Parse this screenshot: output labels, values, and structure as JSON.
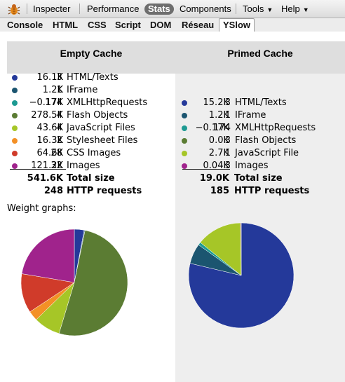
{
  "toolbar": {
    "inspecter": "Inspecter",
    "performance": "Performance",
    "stats": "Stats",
    "components": "Components",
    "tools": "Tools",
    "help": "Help"
  },
  "tabs": [
    "Console",
    "HTML",
    "CSS",
    "Script",
    "DOM",
    "Réseau",
    "YSlow"
  ],
  "active_tab": "YSlow",
  "empty_cache": {
    "title": "Empty Cache",
    "rows": [
      {
        "size": "16.1K",
        "count": "3",
        "label": "HTML/Texts",
        "color": "#24399a"
      },
      {
        "size": "1.2K",
        "count": "1",
        "label": "IFrame",
        "color": "#1b5570"
      },
      {
        "size": "−0.17K",
        "count": "174",
        "label": "XMLHttpRequests",
        "color": "#1d9a92"
      },
      {
        "size": "278.5K",
        "count": "4",
        "label": "Flash Objects",
        "color": "#5b7c33"
      },
      {
        "size": "43.6K",
        "count": "4",
        "label": "JavaScript Files",
        "color": "#a6c627"
      },
      {
        "size": "16.3K",
        "count": "2",
        "label": "Stylesheet Files",
        "color": "#f39026"
      },
      {
        "size": "64.6K",
        "count": "28",
        "label": "CSS Images",
        "color": "#d03b2a"
      },
      {
        "size": "121.2K",
        "count": "32",
        "label": "Images",
        "color": "#a0238c"
      }
    ],
    "total_size": "541.6K",
    "total_size_label": "Total size",
    "http_requests": "248",
    "http_requests_label": "HTTP requests"
  },
  "primed_cache": {
    "title": "Primed Cache",
    "rows": [
      {
        "size": "15.2K",
        "count": "3",
        "label": "HTML/Texts",
        "color": "#24399a"
      },
      {
        "size": "1.2K",
        "count": "1",
        "label": "IFrame",
        "color": "#1b5570"
      },
      {
        "size": "−0.17K",
        "count": "174",
        "label": "XMLHttpRequests",
        "color": "#1d9a92"
      },
      {
        "size": "0.0K",
        "count": "3",
        "label": "Flash Objects",
        "color": "#5b7c33"
      },
      {
        "size": "2.7K",
        "count": "1",
        "label": "JavaScript File",
        "color": "#a6c627"
      },
      {
        "size": "0.04K",
        "count": "3",
        "label": "Images",
        "color": "#a0238c"
      }
    ],
    "total_size": "19.0K",
    "total_size_label": "Total size",
    "http_requests": "185",
    "http_requests_label": "HTTP requests"
  },
  "weight_graphs_label": "Weight graphs:",
  "chart_data": [
    {
      "type": "pie",
      "categories": [
        "HTML/Texts",
        "IFrame",
        "XMLHttpRequests",
        "Flash Objects",
        "JavaScript Files",
        "Stylesheet Files",
        "CSS Images",
        "Images"
      ],
      "values": [
        16.1,
        1.2,
        0.17,
        278.5,
        43.6,
        16.3,
        64.6,
        121.2
      ],
      "colors": [
        "#24399a",
        "#1b5570",
        "#1d9a92",
        "#5b7c33",
        "#a6c627",
        "#f39026",
        "#d03b2a",
        "#a0238c"
      ]
    },
    {
      "type": "pie",
      "categories": [
        "HTML/Texts",
        "IFrame",
        "XMLHttpRequests",
        "Flash Objects",
        "JavaScript File",
        "Images"
      ],
      "values": [
        15.2,
        1.2,
        0.17,
        0.0,
        2.7,
        0.04
      ],
      "colors": [
        "#24399a",
        "#1b5570",
        "#1d9a92",
        "#5b7c33",
        "#a6c627",
        "#a0238c"
      ]
    }
  ]
}
